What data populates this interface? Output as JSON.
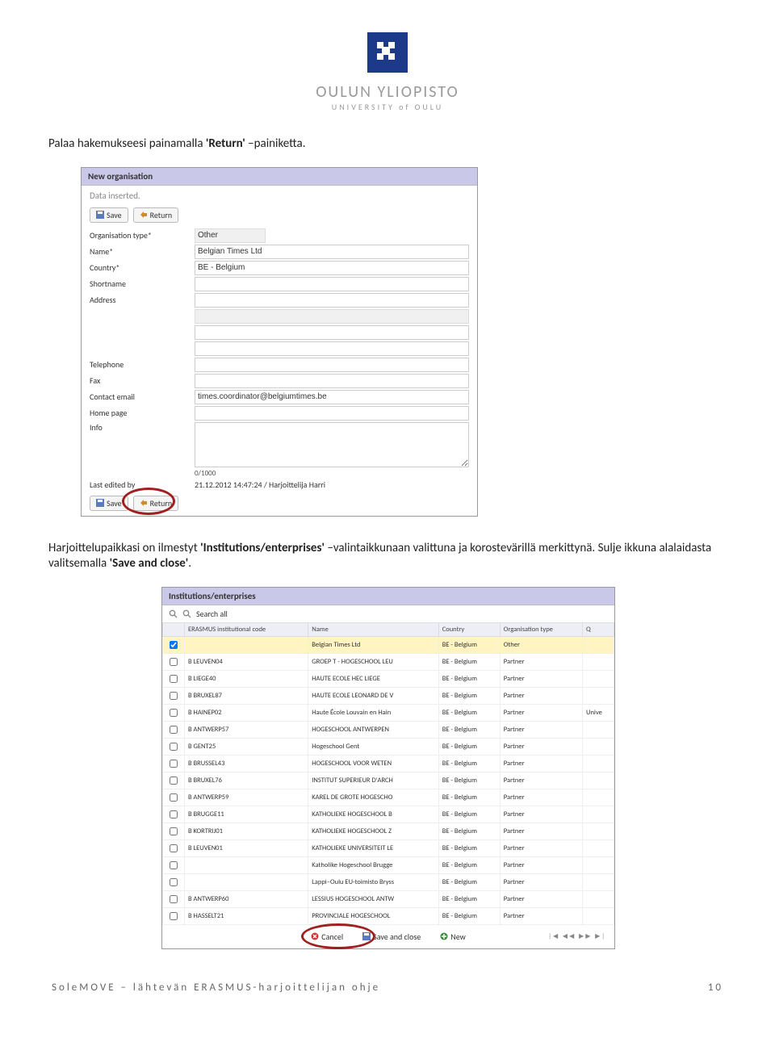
{
  "logo": {
    "name": "OULUN YLIOPISTO",
    "sub": "UNIVERSITY of OULU"
  },
  "para1_a": "Palaa hakemukseesi  painamalla ",
  "para1_b": "'Return'",
  "para1_c": " –painiketta.",
  "form": {
    "title": "New organisation",
    "status": "Data inserted.",
    "save": "Save",
    "return": "Return",
    "orgtype_label": "Organisation type*",
    "orgtype_value": "Other",
    "name_label": "Name*",
    "name_value": "Belgian Times Ltd",
    "country_label": "Country*",
    "country_value": "BE - Belgium",
    "short_label": "Shortname",
    "address_label": "Address",
    "tel_label": "Telephone",
    "fax_label": "Fax",
    "email_label": "Contact email",
    "email_value": "times.coordinator@belgiumtimes.be",
    "home_label": "Home page",
    "info_label": "Info",
    "counter": "0/1000",
    "edited_label": "Last edited by",
    "edited_value": "21.12.2012 14:47:24 / Harjoittelija Harri"
  },
  "para2_a": "Harjoittelupaikkasi on ilmestyt ",
  "para2_b": "'Institutions/enterprises'",
  "para2_c": " –valintaikkunaan valittuna ja korostevärillä merkittynä. Sulje ikkuna  alalaidasta valitsemalla ",
  "para2_d": "'Save and close'",
  "para2_e": ".",
  "table": {
    "title": "Institutions/enterprises",
    "search": "Search all",
    "cols": {
      "code": "ERASMUS institutional code",
      "name": "Name",
      "country": "Country",
      "type": "Organisation type",
      "q": "Q"
    },
    "rows": [
      {
        "sel": true,
        "code": "",
        "name": "Belgian Times Ltd",
        "country": "BE - Belgium",
        "type": "Other",
        "q": ""
      },
      {
        "sel": false,
        "code": "B  LEUVEN04",
        "name": "GROEP T - HOGESCHOOL LEU",
        "country": "BE - Belgium",
        "type": "Partner",
        "q": ""
      },
      {
        "sel": false,
        "code": "B  LIEGE40",
        "name": "HAUTE ECOLE HEC LIEGE",
        "country": "BE - Belgium",
        "type": "Partner",
        "q": ""
      },
      {
        "sel": false,
        "code": "B  BRUXEL87",
        "name": "HAUTE ECOLE LEONARD DE V",
        "country": "BE - Belgium",
        "type": "Partner",
        "q": ""
      },
      {
        "sel": false,
        "code": "B  HAINEP02",
        "name": "Haute École Louvain en Hain",
        "country": "BE - Belgium",
        "type": "Partner",
        "q": "Unive"
      },
      {
        "sel": false,
        "code": "B  ANTWERP57",
        "name": "HOGESCHOOL ANTWERPEN",
        "country": "BE - Belgium",
        "type": "Partner",
        "q": ""
      },
      {
        "sel": false,
        "code": "B  GENT25",
        "name": "Hogeschool Gent",
        "country": "BE - Belgium",
        "type": "Partner",
        "q": ""
      },
      {
        "sel": false,
        "code": "B  BRUSSEL43",
        "name": "HOGESCHOOL VOOR WETEN",
        "country": "BE - Belgium",
        "type": "Partner",
        "q": ""
      },
      {
        "sel": false,
        "code": "B  BRUXEL76",
        "name": "INSTITUT SUPERIEUR D'ARCH",
        "country": "BE - Belgium",
        "type": "Partner",
        "q": ""
      },
      {
        "sel": false,
        "code": "B  ANTWERP59",
        "name": "KAREL DE GROTE HOGESCHO",
        "country": "BE - Belgium",
        "type": "Partner",
        "q": ""
      },
      {
        "sel": false,
        "code": "B  BRUGGE11",
        "name": "KATHOLIEKE HOGESCHOOL B",
        "country": "BE - Belgium",
        "type": "Partner",
        "q": ""
      },
      {
        "sel": false,
        "code": "B  KORTRIJ01",
        "name": "KATHOLIEKE HOGESCHOOL Z",
        "country": "BE - Belgium",
        "type": "Partner",
        "q": ""
      },
      {
        "sel": false,
        "code": "B  LEUVEN01",
        "name": "KATHOLIEKE UNIVERSITEIT LE",
        "country": "BE - Belgium",
        "type": "Partner",
        "q": ""
      },
      {
        "sel": false,
        "code": "",
        "name": "Katholike Hogeschool Brugge",
        "country": "BE - Belgium",
        "type": "Partner",
        "q": ""
      },
      {
        "sel": false,
        "code": "",
        "name": "Lappi–Oulu EU-toimisto Bryss",
        "country": "BE - Belgium",
        "type": "Partner",
        "q": ""
      },
      {
        "sel": false,
        "code": "B  ANTWERP60",
        "name": "LESSIUS HOGESCHOOL ANTW",
        "country": "BE - Belgium",
        "type": "Partner",
        "q": ""
      },
      {
        "sel": false,
        "code": "B  HASSELT21",
        "name": "PROVINCIALE HOGESCHOOL",
        "country": "BE - Belgium",
        "type": "Partner",
        "q": ""
      }
    ],
    "cancel": "Cancel",
    "saveclose": "Save and close",
    "new": "New"
  },
  "footer_left": "SoleMOVE – lähtevän ERASMUS-harjoittelijan ohje",
  "footer_right": "10"
}
